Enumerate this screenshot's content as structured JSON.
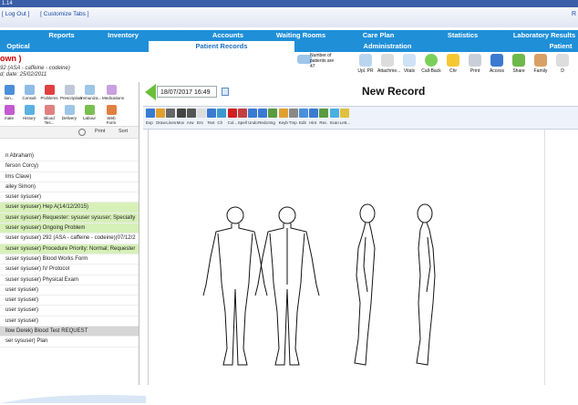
{
  "window": {
    "title": "1.14"
  },
  "menu": {
    "logout": "[ Log Out ]",
    "customize": "[ Customize Tabs ]",
    "right_char": "R"
  },
  "nav_row1": [
    "Reports",
    "Inventory",
    "Accounts",
    "Waiting Rooms",
    "Care Plan",
    "Statistics",
    "Laboratory Results"
  ],
  "nav_row2": [
    "Optical",
    "Patient Records",
    "Administration",
    "Patient"
  ],
  "patient": {
    "name": "own )",
    "allergy": "92 (ASA - caffeine - codeine)",
    "date": "d; date: 25/02/2011"
  },
  "top_icons": {
    "count_label": "Number of patients are",
    "count_value": "47",
    "items": [
      "Upl. PR",
      "Attachme...",
      "Vitals",
      "Call-Back",
      "Chr",
      "Print",
      "Access",
      "Share",
      "Family",
      "D"
    ]
  },
  "left_icons_row1": [
    "tion...",
    "Consult",
    "Problems",
    "Prescription",
    "Immuniza...",
    "Medications"
  ],
  "left_icons_row2": [
    "mate",
    "History",
    "Blood Tes...",
    "Delivery",
    "Labour",
    "Web Form"
  ],
  "left_print": {
    "print": "Print",
    "sort": "Sort"
  },
  "records": [
    {
      "text": "n Abraham)",
      "style": ""
    },
    {
      "text": "ferson Corcy)",
      "style": ""
    },
    {
      "text": "lms Clave)",
      "style": ""
    },
    {
      "text": "ailey Simon)",
      "style": ""
    },
    {
      "text": "suser sysuser)",
      "style": ""
    },
    {
      "text": "suser sysuser) Hep A(14/12/2015)",
      "style": "hl"
    },
    {
      "text": "suser sysuser) Requester: sysuser sysuser; Specialty",
      "style": "hl"
    },
    {
      "text": "suser sysuser) Ongoing Problem",
      "style": "hl"
    },
    {
      "text": "suser sysuser) 292 (ASA - caffeine - codeine)(07/12/2",
      "style": ""
    },
    {
      "text": "suser sysuser) Procedure Priority: Normal; Requester",
      "style": "hl"
    },
    {
      "text": "suser sysuser) Blood Works Form",
      "style": ""
    },
    {
      "text": "suser sysuser) IV Protocol",
      "style": ""
    },
    {
      "text": "suser sysuser) Physical Exam",
      "style": ""
    },
    {
      "text": "user sysuser)",
      "style": ""
    },
    {
      "text": "user sysuser)",
      "style": ""
    },
    {
      "text": "user sysuser)",
      "style": ""
    },
    {
      "text": "user sysuser)",
      "style": ""
    },
    {
      "text": "llow Derek) Blood Test REQUEST",
      "style": "gr"
    },
    {
      "text": "ser sysuser) Plan",
      "style": ""
    }
  ],
  "record": {
    "date": "18/07/2017 16:49",
    "title": "New Record"
  },
  "toolbar_labels": [
    "Exp",
    "Draw",
    "Lines",
    "Mov",
    "Arw",
    "Ers",
    "Text",
    "Clr",
    "Col...",
    "Spell",
    "Undo",
    "Redo",
    "Img",
    "Keyb",
    "Tmp",
    "Edit",
    "Hint",
    "Rec.",
    "Scan",
    "Lett..."
  ],
  "colors": {
    "nav": "#1f8fd8",
    "highlight": "#d6f0b8",
    "patient_name": "#cc0000"
  }
}
